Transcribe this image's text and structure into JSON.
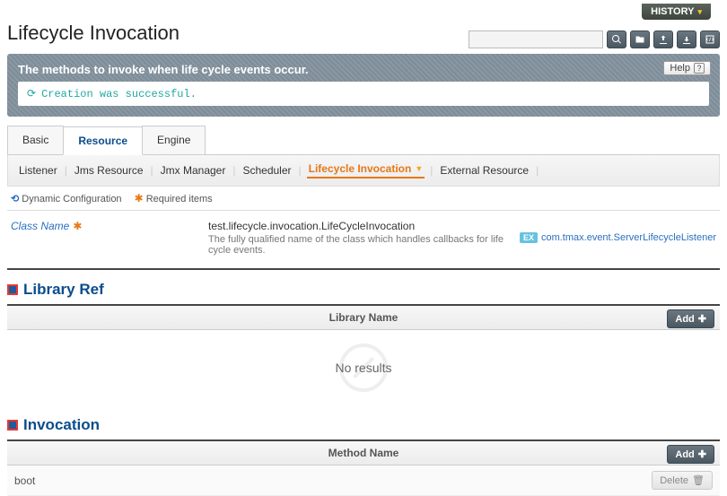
{
  "header": {
    "history_label": "HISTORY",
    "title": "Lifecycle Invocation",
    "search_placeholder": ""
  },
  "info": {
    "description": "The methods to invoke when life cycle events occur.",
    "help_label": "Help",
    "status_message": "Creation was successful."
  },
  "tabs_primary": {
    "items": [
      {
        "label": "Basic",
        "active": false
      },
      {
        "label": "Resource",
        "active": true
      },
      {
        "label": "Engine",
        "active": false
      }
    ]
  },
  "tabs_secondary": {
    "items": [
      {
        "label": "Listener",
        "active": false
      },
      {
        "label": "Jms Resource",
        "active": false
      },
      {
        "label": "Jmx Manager",
        "active": false
      },
      {
        "label": "Scheduler",
        "active": false
      },
      {
        "label": "Lifecycle Invocation",
        "active": true
      },
      {
        "label": "External Resource",
        "active": false
      }
    ]
  },
  "legend": {
    "dynamic_label": "Dynamic Configuration",
    "required_label": "Required items"
  },
  "class_field": {
    "label": "Class Name",
    "value": "test.lifecycle.invocation.LifeCycleInvocation",
    "hint": "The fully qualified name of the class which handles callbacks for life cycle events.",
    "example_badge": "EX",
    "example": "com.tmax.event.ServerLifecycleListener"
  },
  "sections": {
    "library": {
      "title": "Library Ref",
      "column": "Library Name",
      "add_label": "Add",
      "no_results": "No results",
      "rows": []
    },
    "invocation": {
      "title": "Invocation",
      "column": "Method Name",
      "add_label": "Add",
      "delete_label": "Delete",
      "rows": [
        {
          "method_name": "boot"
        }
      ]
    }
  }
}
